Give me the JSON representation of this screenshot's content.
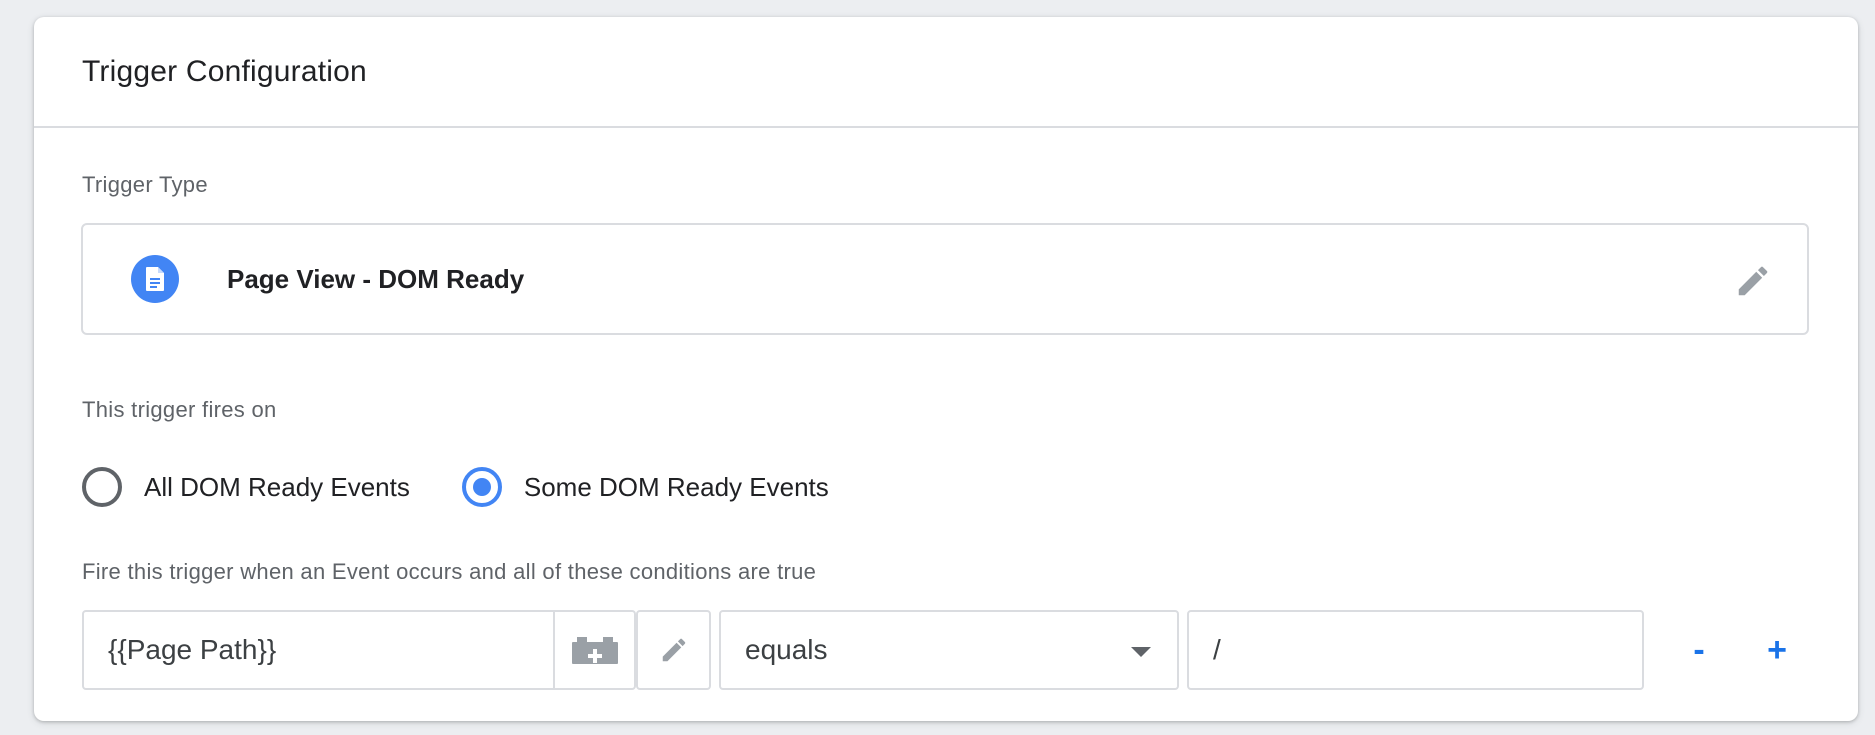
{
  "card": {
    "title": "Trigger Configuration"
  },
  "trigger_type": {
    "label": "Trigger Type",
    "name": "Page View - DOM Ready",
    "icon": "document-icon",
    "icon_color": "#4285f4"
  },
  "fires_on": {
    "label": "This trigger fires on",
    "options": [
      {
        "label": "All DOM Ready Events",
        "checked": false
      },
      {
        "label": "Some DOM Ready Events",
        "checked": true
      }
    ]
  },
  "conditions": {
    "label": "Fire this trigger when an Event occurs and all of these conditions are true",
    "rows": [
      {
        "variable": "{{Page Path}}",
        "operator": "equals",
        "value": "/"
      }
    ],
    "remove_label": "-",
    "add_label": "+"
  },
  "colors": {
    "accent": "#1a73e8",
    "radio_active": "#4285f4",
    "border": "#dadce0"
  }
}
